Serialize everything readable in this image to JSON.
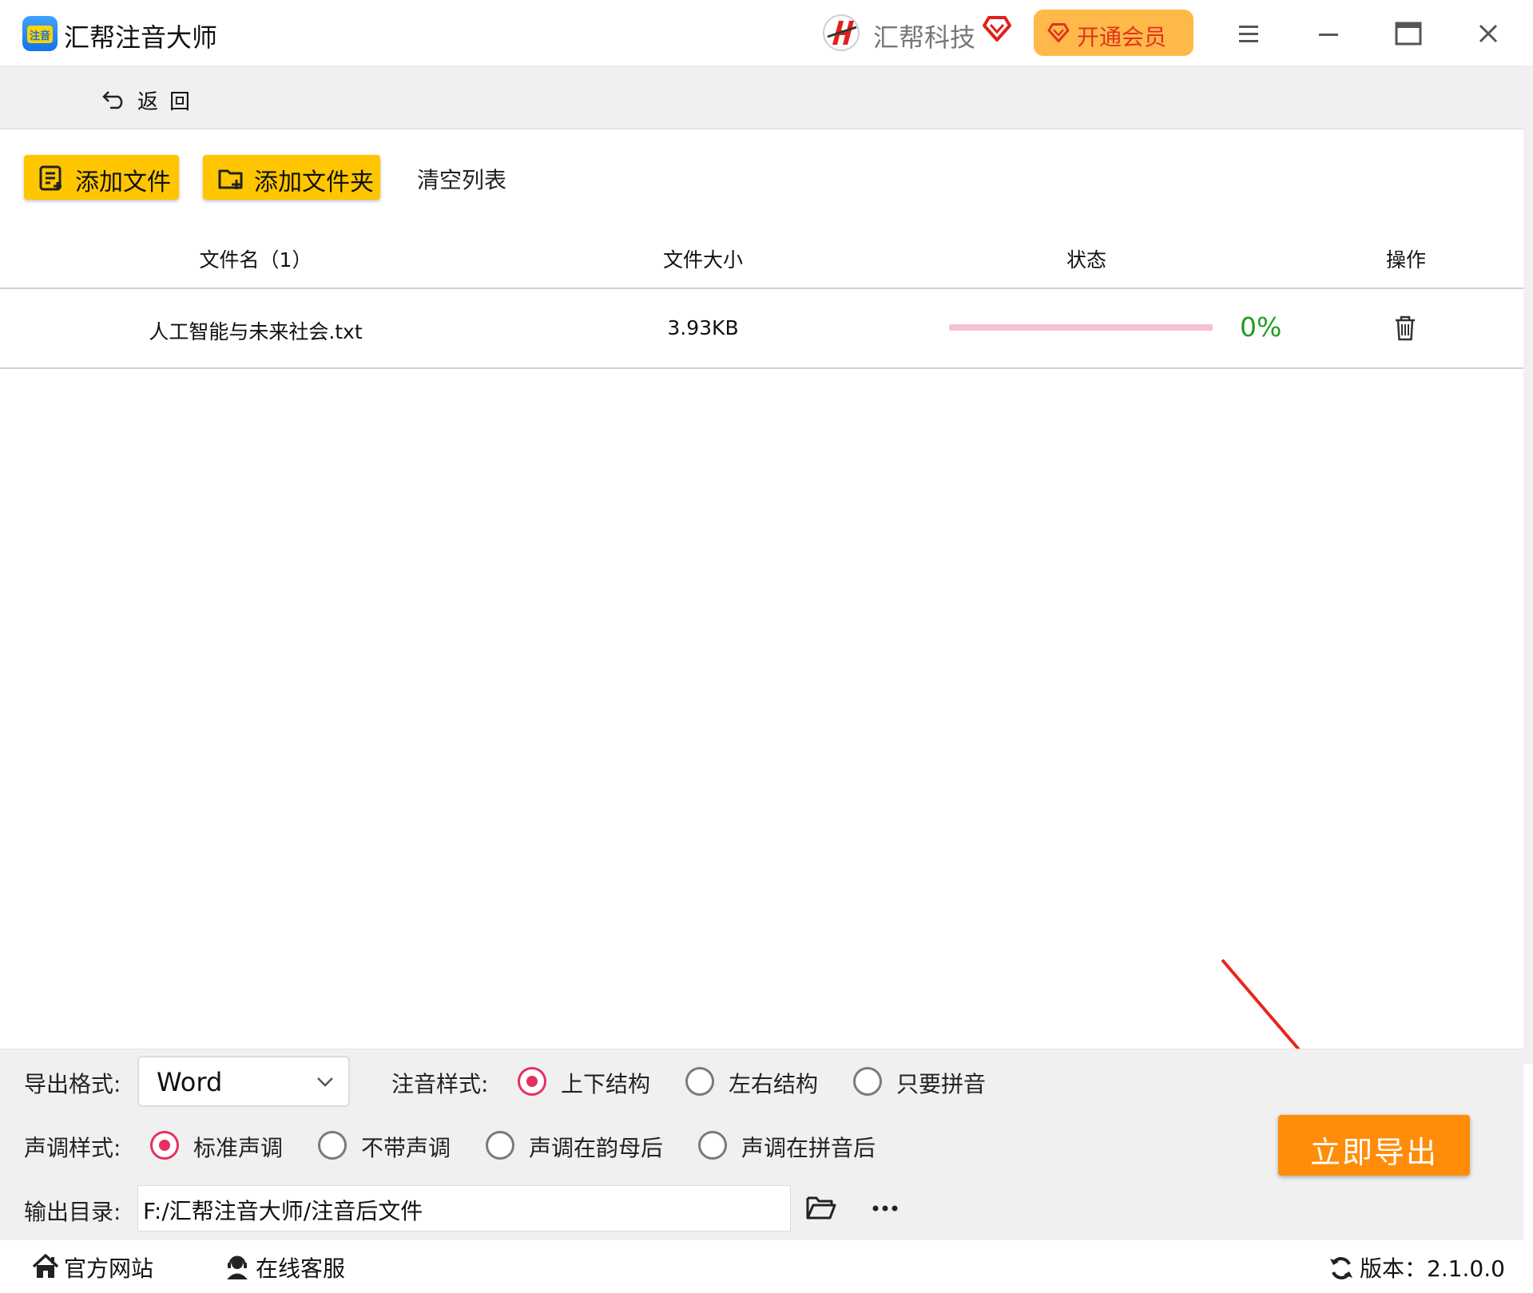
{
  "titlebar": {
    "app_logo_text": "注音",
    "app_title": "汇帮注音大师",
    "brand_name": "汇帮科技",
    "vip_label": "开通会员"
  },
  "nav": {
    "back_label": "返回"
  },
  "toolbar": {
    "add_file": "添加文件",
    "add_folder": "添加文件夹",
    "clear_list": "清空列表"
  },
  "table": {
    "headers": {
      "name": "文件名（1）",
      "size": "文件大小",
      "status": "状态",
      "action": "操作"
    },
    "rows": [
      {
        "name": "人工智能与未来社会.txt",
        "size": "3.93KB",
        "percent_text": "0%",
        "progress": 0
      }
    ]
  },
  "settings": {
    "format_label": "导出格式:",
    "format_value": "Word",
    "pinyin_style_label": "注音样式:",
    "pinyin_options": [
      "上下结构",
      "左右结构",
      "只要拼音"
    ],
    "pinyin_selected": 0,
    "tone_style_label": "声调样式:",
    "tone_options": [
      "标准声调",
      "不带声调",
      "声调在韵母后",
      "声调在拼音后"
    ],
    "tone_selected": 0,
    "output_label": "输出目录:",
    "output_path": "F:/汇帮注音大师/注音后文件",
    "export_label": "立即导出"
  },
  "footer": {
    "official_site": "官方网站",
    "support": "在线客服",
    "version": "版本：2.1.0.0"
  },
  "colors": {
    "accent_yellow": "#ffc600",
    "export_orange": "#ff8d0a",
    "vip_orange": "#ffb84a",
    "radio_pink": "#e5315f",
    "progress_track": "#f5c3cf",
    "percent_green": "#1f9e1f",
    "annotation_arrow": "#e8261c"
  }
}
